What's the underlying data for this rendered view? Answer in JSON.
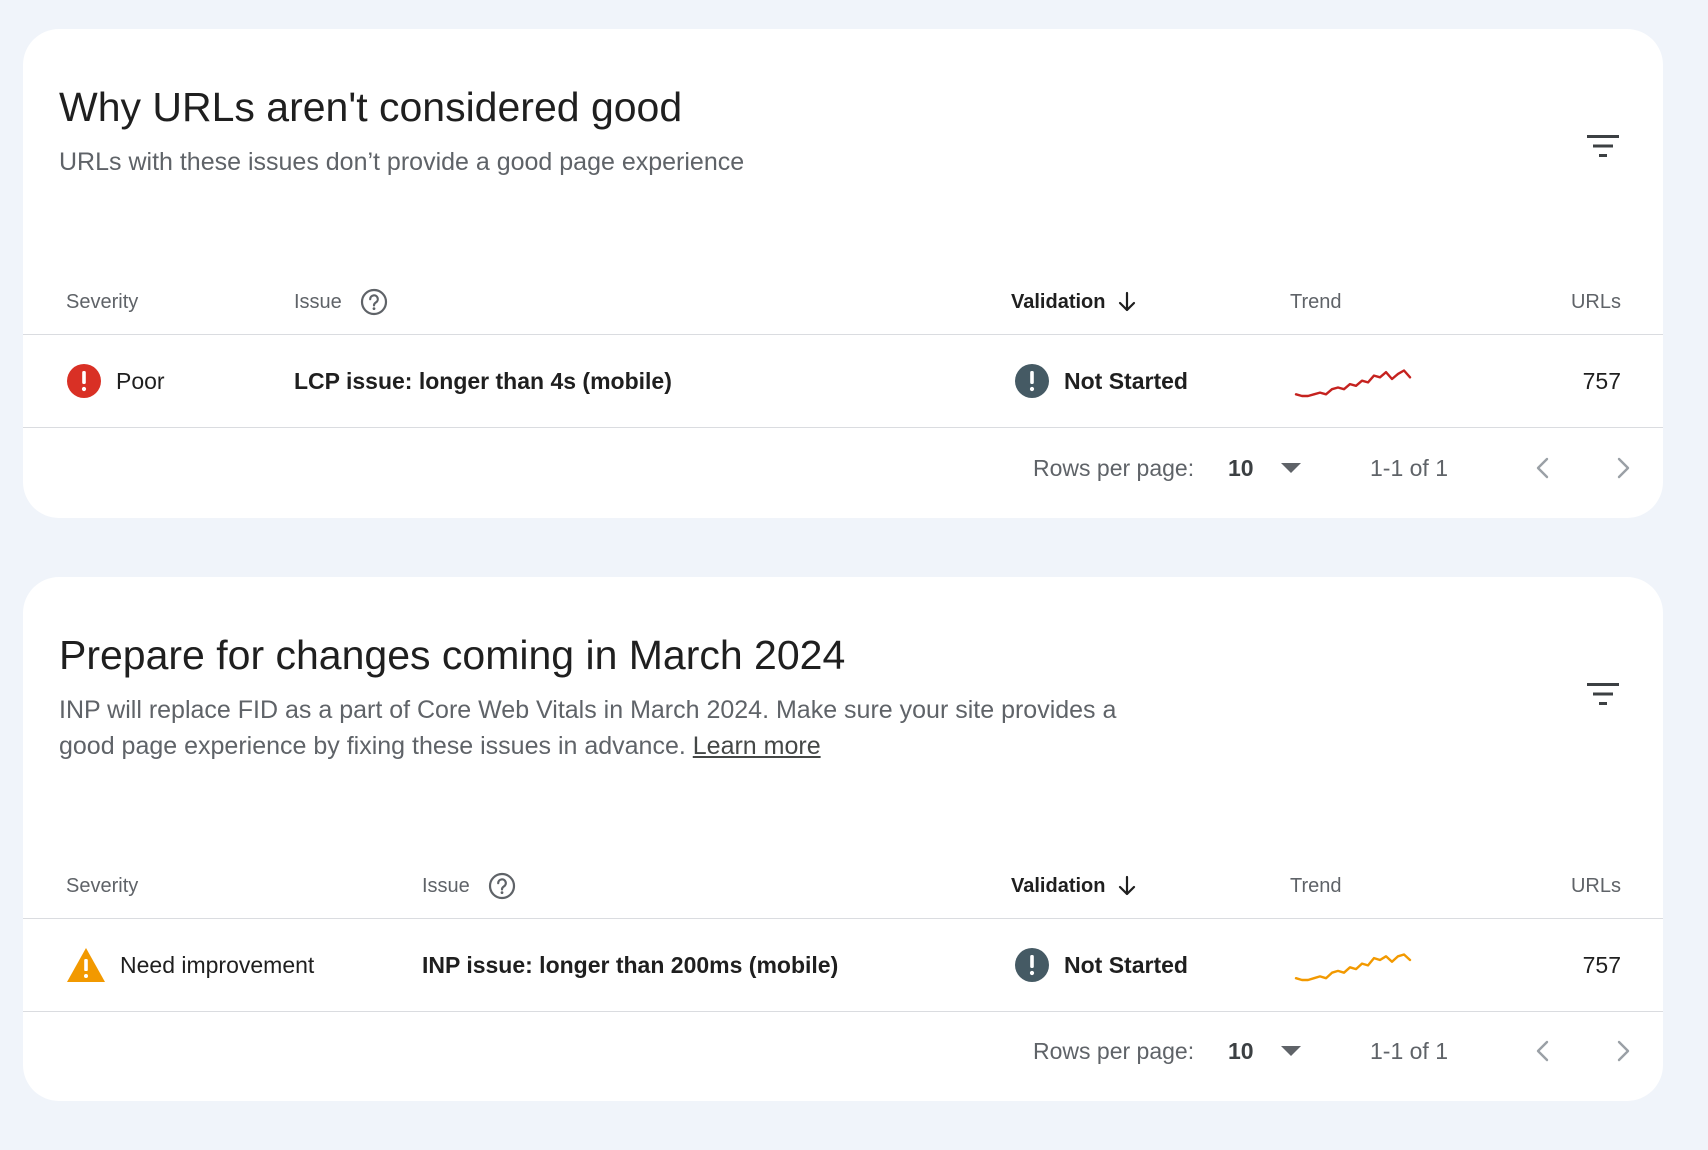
{
  "colors": {
    "page_bg": "#f0f4fa",
    "poor": "#d93025",
    "warning": "#f29900",
    "status": "#455a64",
    "trend_poor": "#c5221f",
    "trend_warning": "#f29900"
  },
  "cards": [
    {
      "title": "Why URLs aren't considered good",
      "subtitle": "URLs with these issues don’t provide a good page experience",
      "columns": {
        "severity": "Severity",
        "issue": "Issue",
        "validation": "Validation",
        "trend": "Trend",
        "urls": "URLs"
      },
      "rows": [
        {
          "severity": "Poor",
          "severity_icon": "error-circle-icon",
          "issue": "LCP issue: longer than 4s (mobile)",
          "validation": "Not Started",
          "validation_icon": "exclamation-circle-icon",
          "trend_values": [
            3,
            2,
            2,
            3,
            4,
            3,
            6,
            7,
            6,
            9,
            8,
            11,
            10,
            14,
            13,
            16,
            12,
            15,
            17,
            13
          ],
          "urls": "757"
        }
      ],
      "pagination": {
        "rows_per_page_label": "Rows per page:",
        "rows_per_page_value": "10",
        "range": "1-1 of 1"
      }
    },
    {
      "title": "Prepare for changes coming in March 2024",
      "subtitle": "INP will replace FID as a part of Core Web Vitals in March 2024. Make sure your site provides a good page experience by fixing these issues in advance.",
      "link_text": "Learn more",
      "columns": {
        "severity": "Severity",
        "issue": "Issue",
        "validation": "Validation",
        "trend": "Trend",
        "urls": "URLs"
      },
      "rows": [
        {
          "severity": "Need improvement",
          "severity_icon": "warning-triangle-icon",
          "issue": "INP issue: longer than 200ms (mobile)",
          "validation": "Not Started",
          "validation_icon": "exclamation-circle-icon",
          "trend_values": [
            4,
            3,
            3,
            4,
            5,
            4,
            7,
            8,
            7,
            10,
            9,
            12,
            11,
            15,
            14,
            16,
            13,
            16,
            17,
            14
          ],
          "urls": "757"
        }
      ],
      "pagination": {
        "rows_per_page_label": "Rows per page:",
        "rows_per_page_value": "10",
        "range": "1-1 of 1"
      }
    }
  ]
}
